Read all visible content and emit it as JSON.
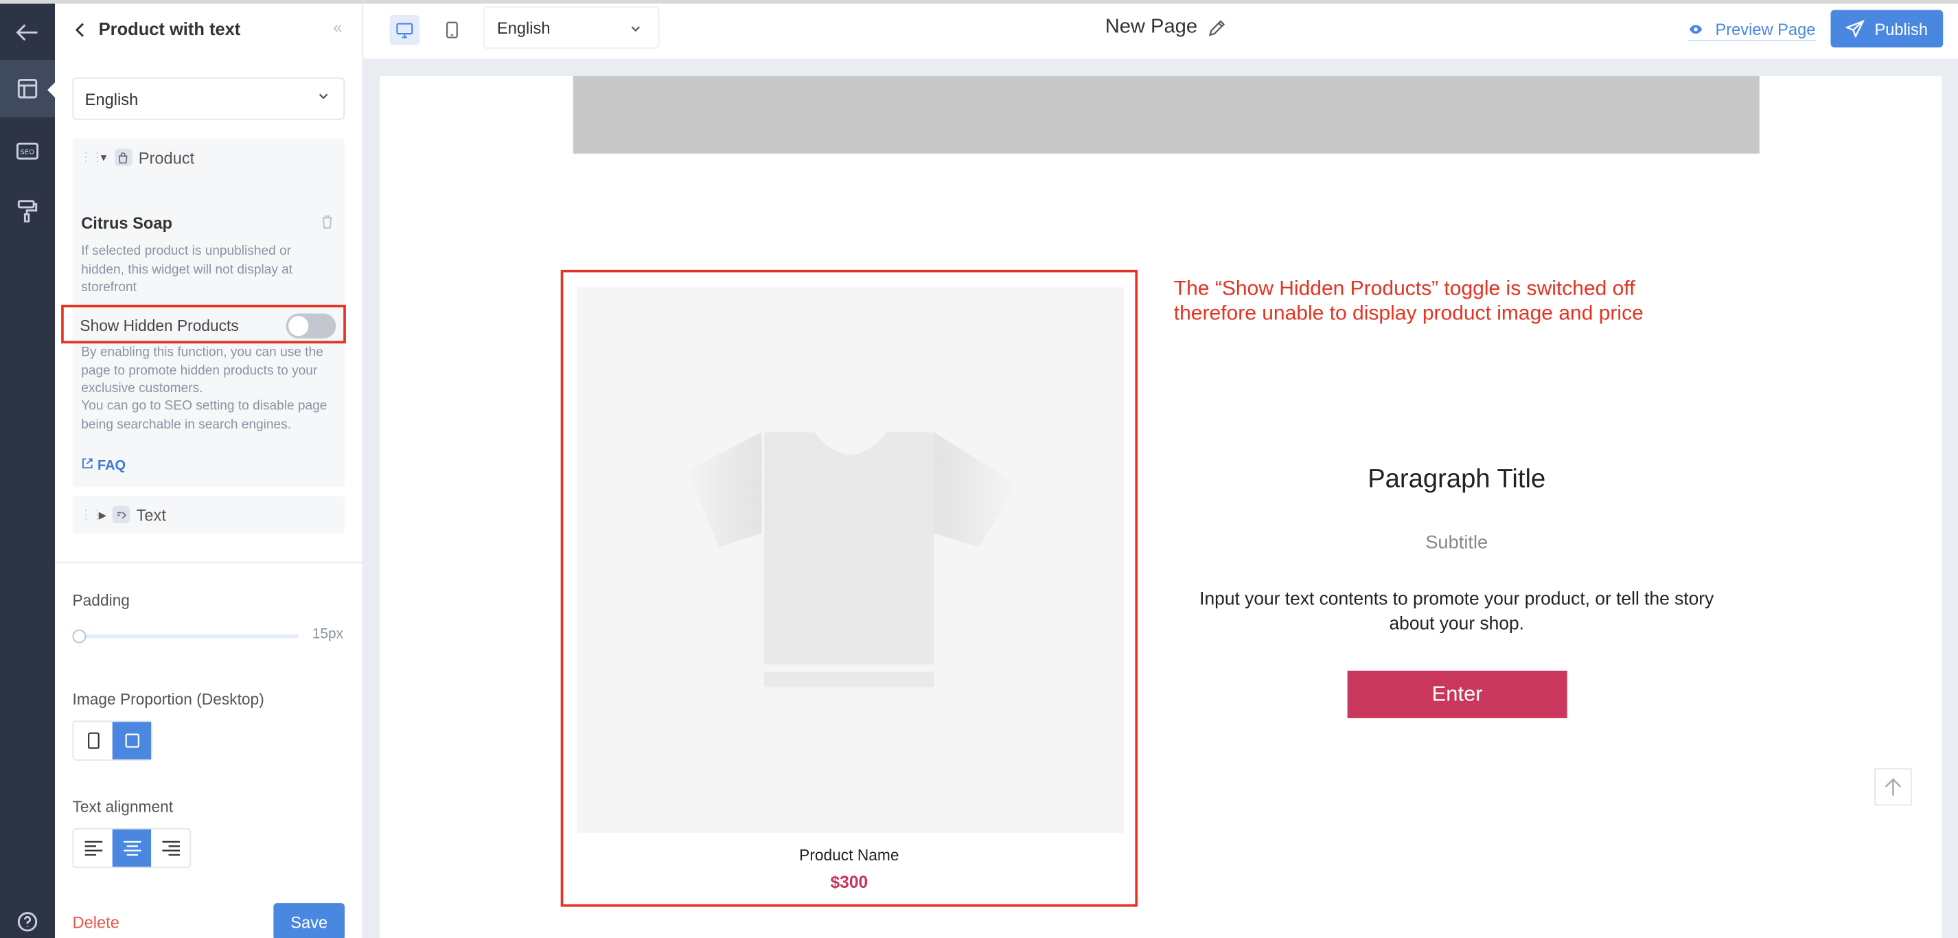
{
  "panel": {
    "title": "Product with text",
    "language": "English",
    "product_group_label": "Product",
    "product_name": "Citrus Soap",
    "product_hint": "If selected product is unpublished or hidden, this widget will not display at storefront",
    "toggle_label": "Show Hidden Products",
    "toggle_on": false,
    "toggle_hint_1": "By enabling this function, you can use the page to promote hidden products to your exclusive customers.",
    "toggle_hint_2": "You can go to SEO setting to disable page being searchable in search engines.",
    "faq_label": "FAQ",
    "text_group_label": "Text",
    "padding_label": "Padding",
    "padding_value": "15px",
    "image_proportion_label": "Image Proportion (Desktop)",
    "text_alignment_label": "Text alignment",
    "delete_label": "Delete",
    "save_label": "Save"
  },
  "topbar": {
    "language": "English",
    "page_title": "New Page",
    "preview_label": "Preview Page",
    "publish_label": "Publish"
  },
  "canvas": {
    "product_label": "Product Name",
    "product_price": "$300",
    "note_line_1": "The “Show Hidden Products” toggle is switched off",
    "note_line_2": "therefore unable to display product image and price",
    "paragraph_title": "Paragraph Title",
    "subtitle": "Subtitle",
    "body_text": "Input your text contents to promote your product, or tell the story about your shop.",
    "button_label": "Enter"
  },
  "colors": {
    "accent": "#4a87e0",
    "annotation": "#e53321",
    "brand_button": "#c9385c",
    "rail": "#2c3446"
  },
  "icons": [
    "back-arrow-icon",
    "layout-icon",
    "seo-icon",
    "paint-roller-icon",
    "help-icon",
    "desktop-icon",
    "mobile-icon",
    "pencil-icon",
    "eye-icon",
    "send-icon",
    "trash-icon",
    "link-icon",
    "arrow-up-icon"
  ]
}
